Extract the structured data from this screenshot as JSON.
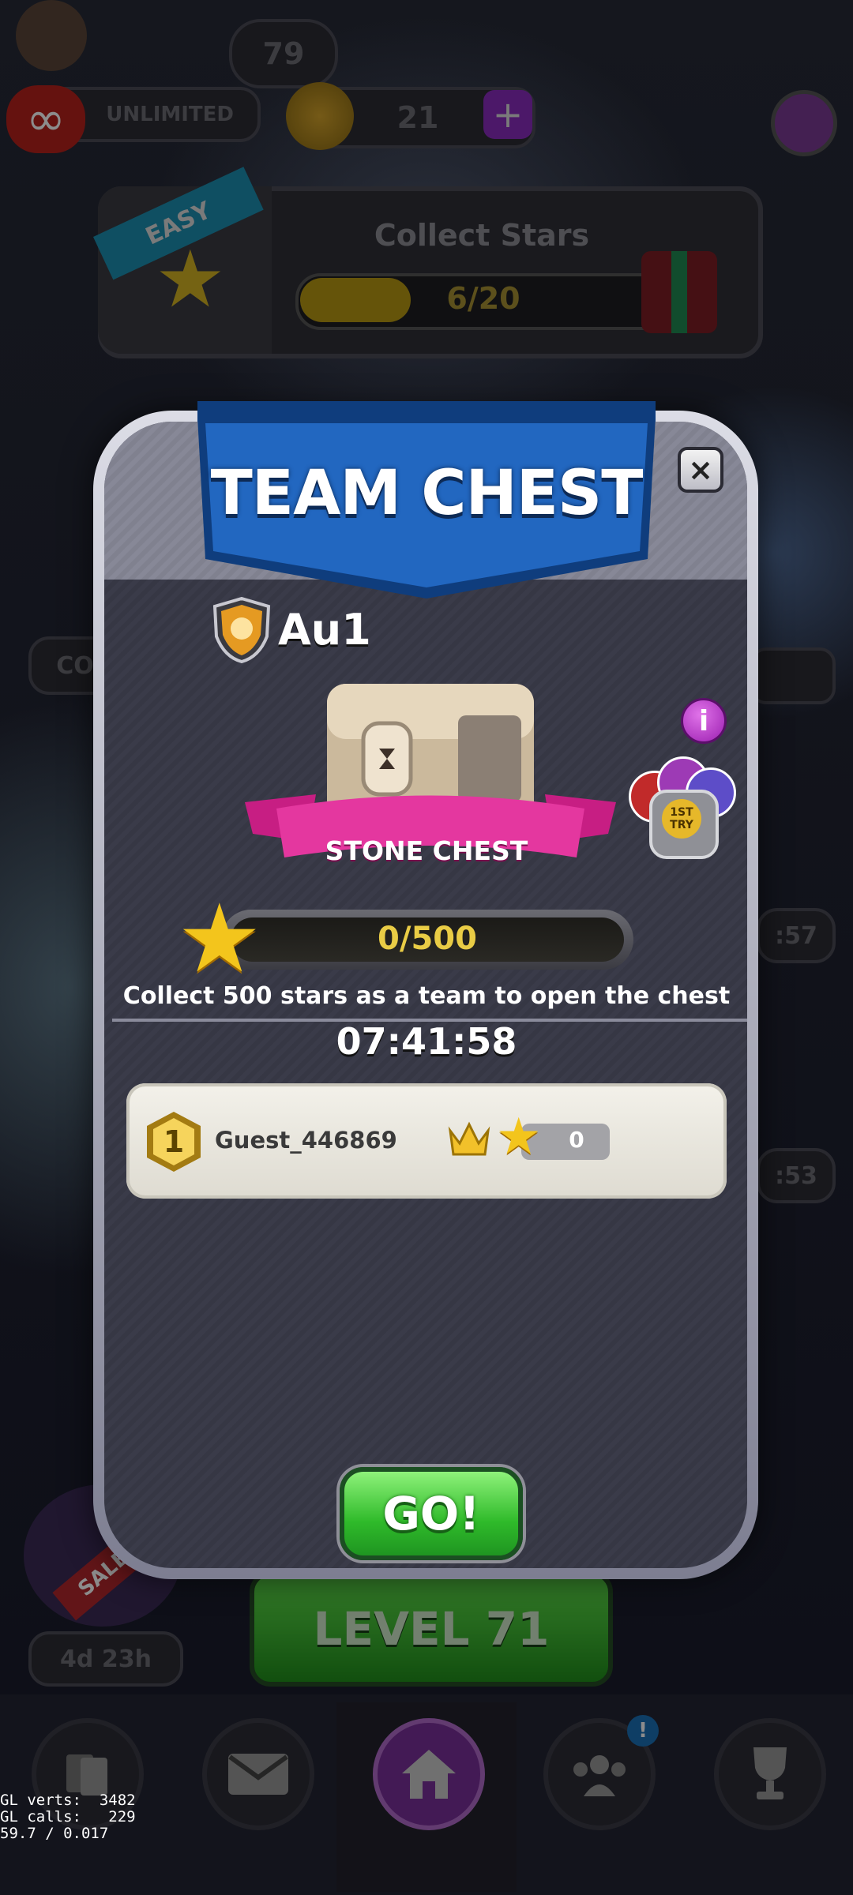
{
  "colors": {
    "accent_pink": "#e4379f",
    "go_green": "#3ccb30",
    "banner_blue": "#1d5fb0",
    "gold": "#e9cc45"
  },
  "hud": {
    "level_bubble_top": "79",
    "lives_label": "UNLIMITED",
    "coins_value": "21",
    "coins_add_icon": "plus-icon",
    "settings_icon": "gear-icon"
  },
  "quest": {
    "difficulty": "EASY",
    "title": "Collect Stars",
    "progress_text": "6/20",
    "progress": 0.3
  },
  "map_labels": {
    "left_pill": "CO",
    "timer_a": ":57",
    "timer_b": ":53",
    "sale": "SALE",
    "sale_timer": "4d 23h",
    "level_button": "LEVEL 71"
  },
  "modal": {
    "title": "TEAM CHEST",
    "team_name": "Au1",
    "chest_label": "STONE CHEST",
    "info_icon": "i",
    "progress_text": "0/500",
    "progress": 0,
    "description": "Collect 500 stars as a team to open the chest",
    "timer": "07:41:58",
    "members": [
      {
        "rank": "1",
        "name": "Guest_446869",
        "score": "0"
      }
    ],
    "go_label": "GO!",
    "close_label": "×",
    "badge_text": "1ST TRY"
  },
  "nav": {
    "items": [
      "cards-icon",
      "mail-icon",
      "home-icon",
      "team-icon",
      "trophy-icon"
    ],
    "team_notification": "!"
  },
  "debug": {
    "line1": "GL verts:  3482",
    "line2": "GL calls:   229",
    "line3": "59.7 / 0.017"
  }
}
